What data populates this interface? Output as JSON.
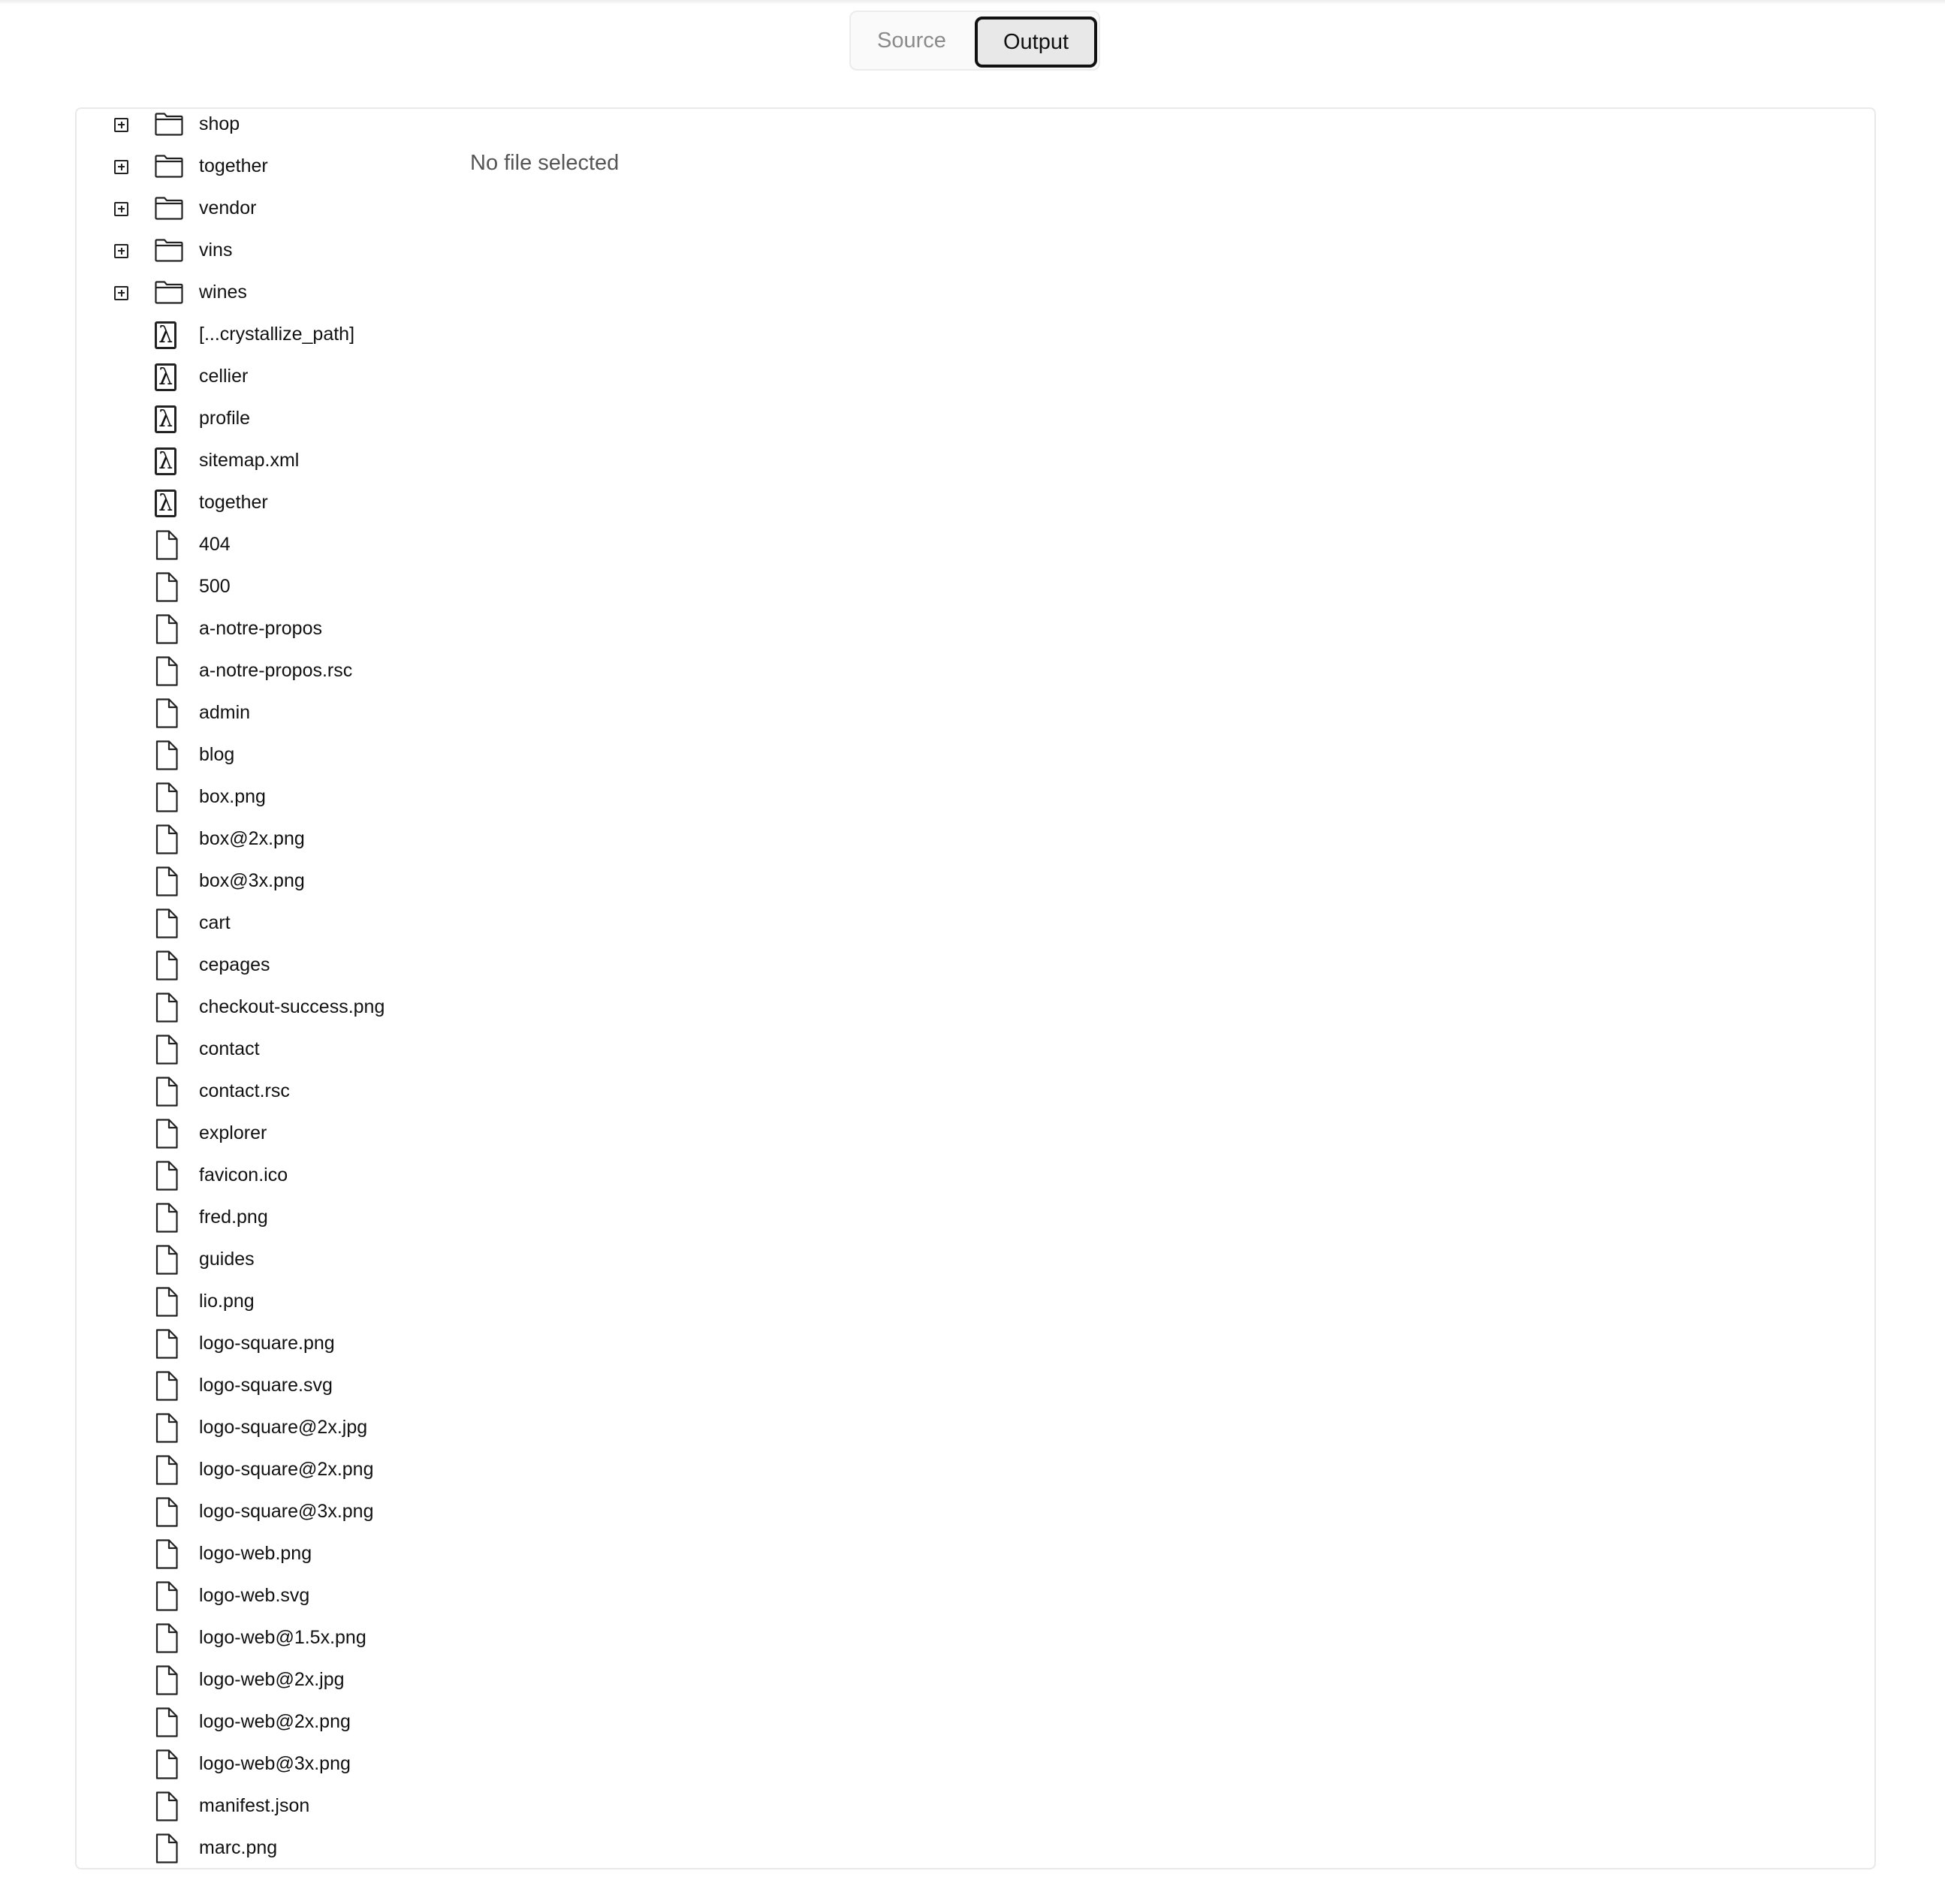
{
  "view_tabs": {
    "source_label": "Source",
    "output_label": "Output",
    "active": "Output"
  },
  "preview": {
    "empty_message": "No file selected"
  },
  "tree": {
    "items": [
      {
        "name": "shop",
        "kind": "folder"
      },
      {
        "name": "together",
        "kind": "folder"
      },
      {
        "name": "vendor",
        "kind": "folder"
      },
      {
        "name": "vins",
        "kind": "folder"
      },
      {
        "name": "wines",
        "kind": "folder"
      },
      {
        "name": "[...crystallize_path]",
        "kind": "function"
      },
      {
        "name": "cellier",
        "kind": "function"
      },
      {
        "name": "profile",
        "kind": "function"
      },
      {
        "name": "sitemap.xml",
        "kind": "function"
      },
      {
        "name": "together",
        "kind": "function"
      },
      {
        "name": "404",
        "kind": "file"
      },
      {
        "name": "500",
        "kind": "file"
      },
      {
        "name": "a-notre-propos",
        "kind": "file"
      },
      {
        "name": "a-notre-propos.rsc",
        "kind": "file"
      },
      {
        "name": "admin",
        "kind": "file"
      },
      {
        "name": "blog",
        "kind": "file"
      },
      {
        "name": "box.png",
        "kind": "file"
      },
      {
        "name": "box@2x.png",
        "kind": "file"
      },
      {
        "name": "box@3x.png",
        "kind": "file"
      },
      {
        "name": "cart",
        "kind": "file"
      },
      {
        "name": "cepages",
        "kind": "file"
      },
      {
        "name": "checkout-success.png",
        "kind": "file"
      },
      {
        "name": "contact",
        "kind": "file"
      },
      {
        "name": "contact.rsc",
        "kind": "file"
      },
      {
        "name": "explorer",
        "kind": "file"
      },
      {
        "name": "favicon.ico",
        "kind": "file"
      },
      {
        "name": "fred.png",
        "kind": "file"
      },
      {
        "name": "guides",
        "kind": "file"
      },
      {
        "name": "lio.png",
        "kind": "file"
      },
      {
        "name": "logo-square.png",
        "kind": "file"
      },
      {
        "name": "logo-square.svg",
        "kind": "file"
      },
      {
        "name": "logo-square@2x.jpg",
        "kind": "file"
      },
      {
        "name": "logo-square@2x.png",
        "kind": "file"
      },
      {
        "name": "logo-square@3x.png",
        "kind": "file"
      },
      {
        "name": "logo-web.png",
        "kind": "file"
      },
      {
        "name": "logo-web.svg",
        "kind": "file"
      },
      {
        "name": "logo-web@1.5x.png",
        "kind": "file"
      },
      {
        "name": "logo-web@2x.jpg",
        "kind": "file"
      },
      {
        "name": "logo-web@2x.png",
        "kind": "file"
      },
      {
        "name": "logo-web@3x.png",
        "kind": "file"
      },
      {
        "name": "manifest.json",
        "kind": "file"
      },
      {
        "name": "marc.png",
        "kind": "file"
      }
    ]
  }
}
